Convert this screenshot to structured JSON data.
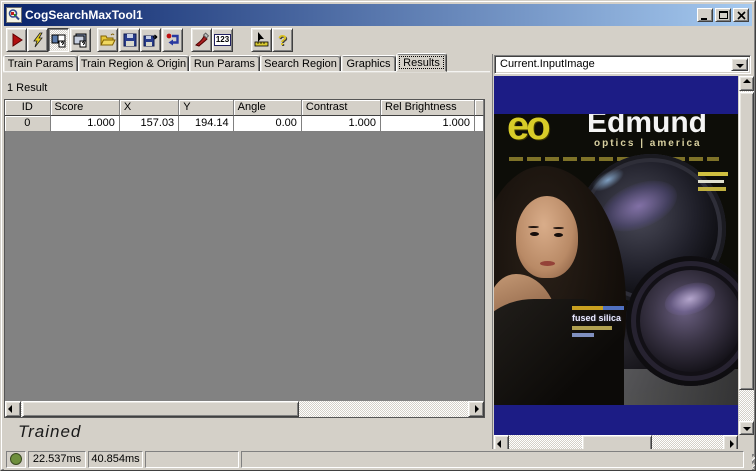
{
  "window": {
    "title": "CogSearchMaxTool1"
  },
  "toolbar": {
    "buttons": [
      "run",
      "electric-run",
      "show-current-record",
      "float-result-window",
      "open-file",
      "save",
      "save-as",
      "reset",
      "edit-tool-graphics",
      "show-numeric-results",
      "pointer-measure",
      "help"
    ],
    "numbers_label": "123",
    "help_label": "?"
  },
  "tabs": {
    "items": [
      "Train Params",
      "Train Region & Origin",
      "Run Params",
      "Search Region",
      "Graphics",
      "Results"
    ],
    "active": "Results"
  },
  "results": {
    "count_label": "1 Result",
    "state_label": "Trained",
    "table": {
      "columns": [
        "ID",
        "Score",
        "X",
        "Y",
        "Angle",
        "Contrast",
        "Rel Brightness"
      ],
      "rows": [
        [
          "0",
          "1.000",
          "157.03",
          "194.14",
          "0.00",
          "1.000",
          "1.000"
        ]
      ]
    }
  },
  "image_panel": {
    "selector_value": "Current.InputImage",
    "catalog": {
      "logo": "eo",
      "brand": "Edmund",
      "subline": "optics | america",
      "feature_text": "fused silica"
    }
  },
  "status": {
    "times": [
      "22.537ms",
      "40.854ms"
    ],
    "indicator_color": "#6e8f3d"
  },
  "colors": {
    "titlebar_start": "#0a246a",
    "titlebar_end": "#a6caf0",
    "face": "#d4d0c8",
    "grid_empty": "#828282",
    "navy_band": "#1c1c85"
  }
}
